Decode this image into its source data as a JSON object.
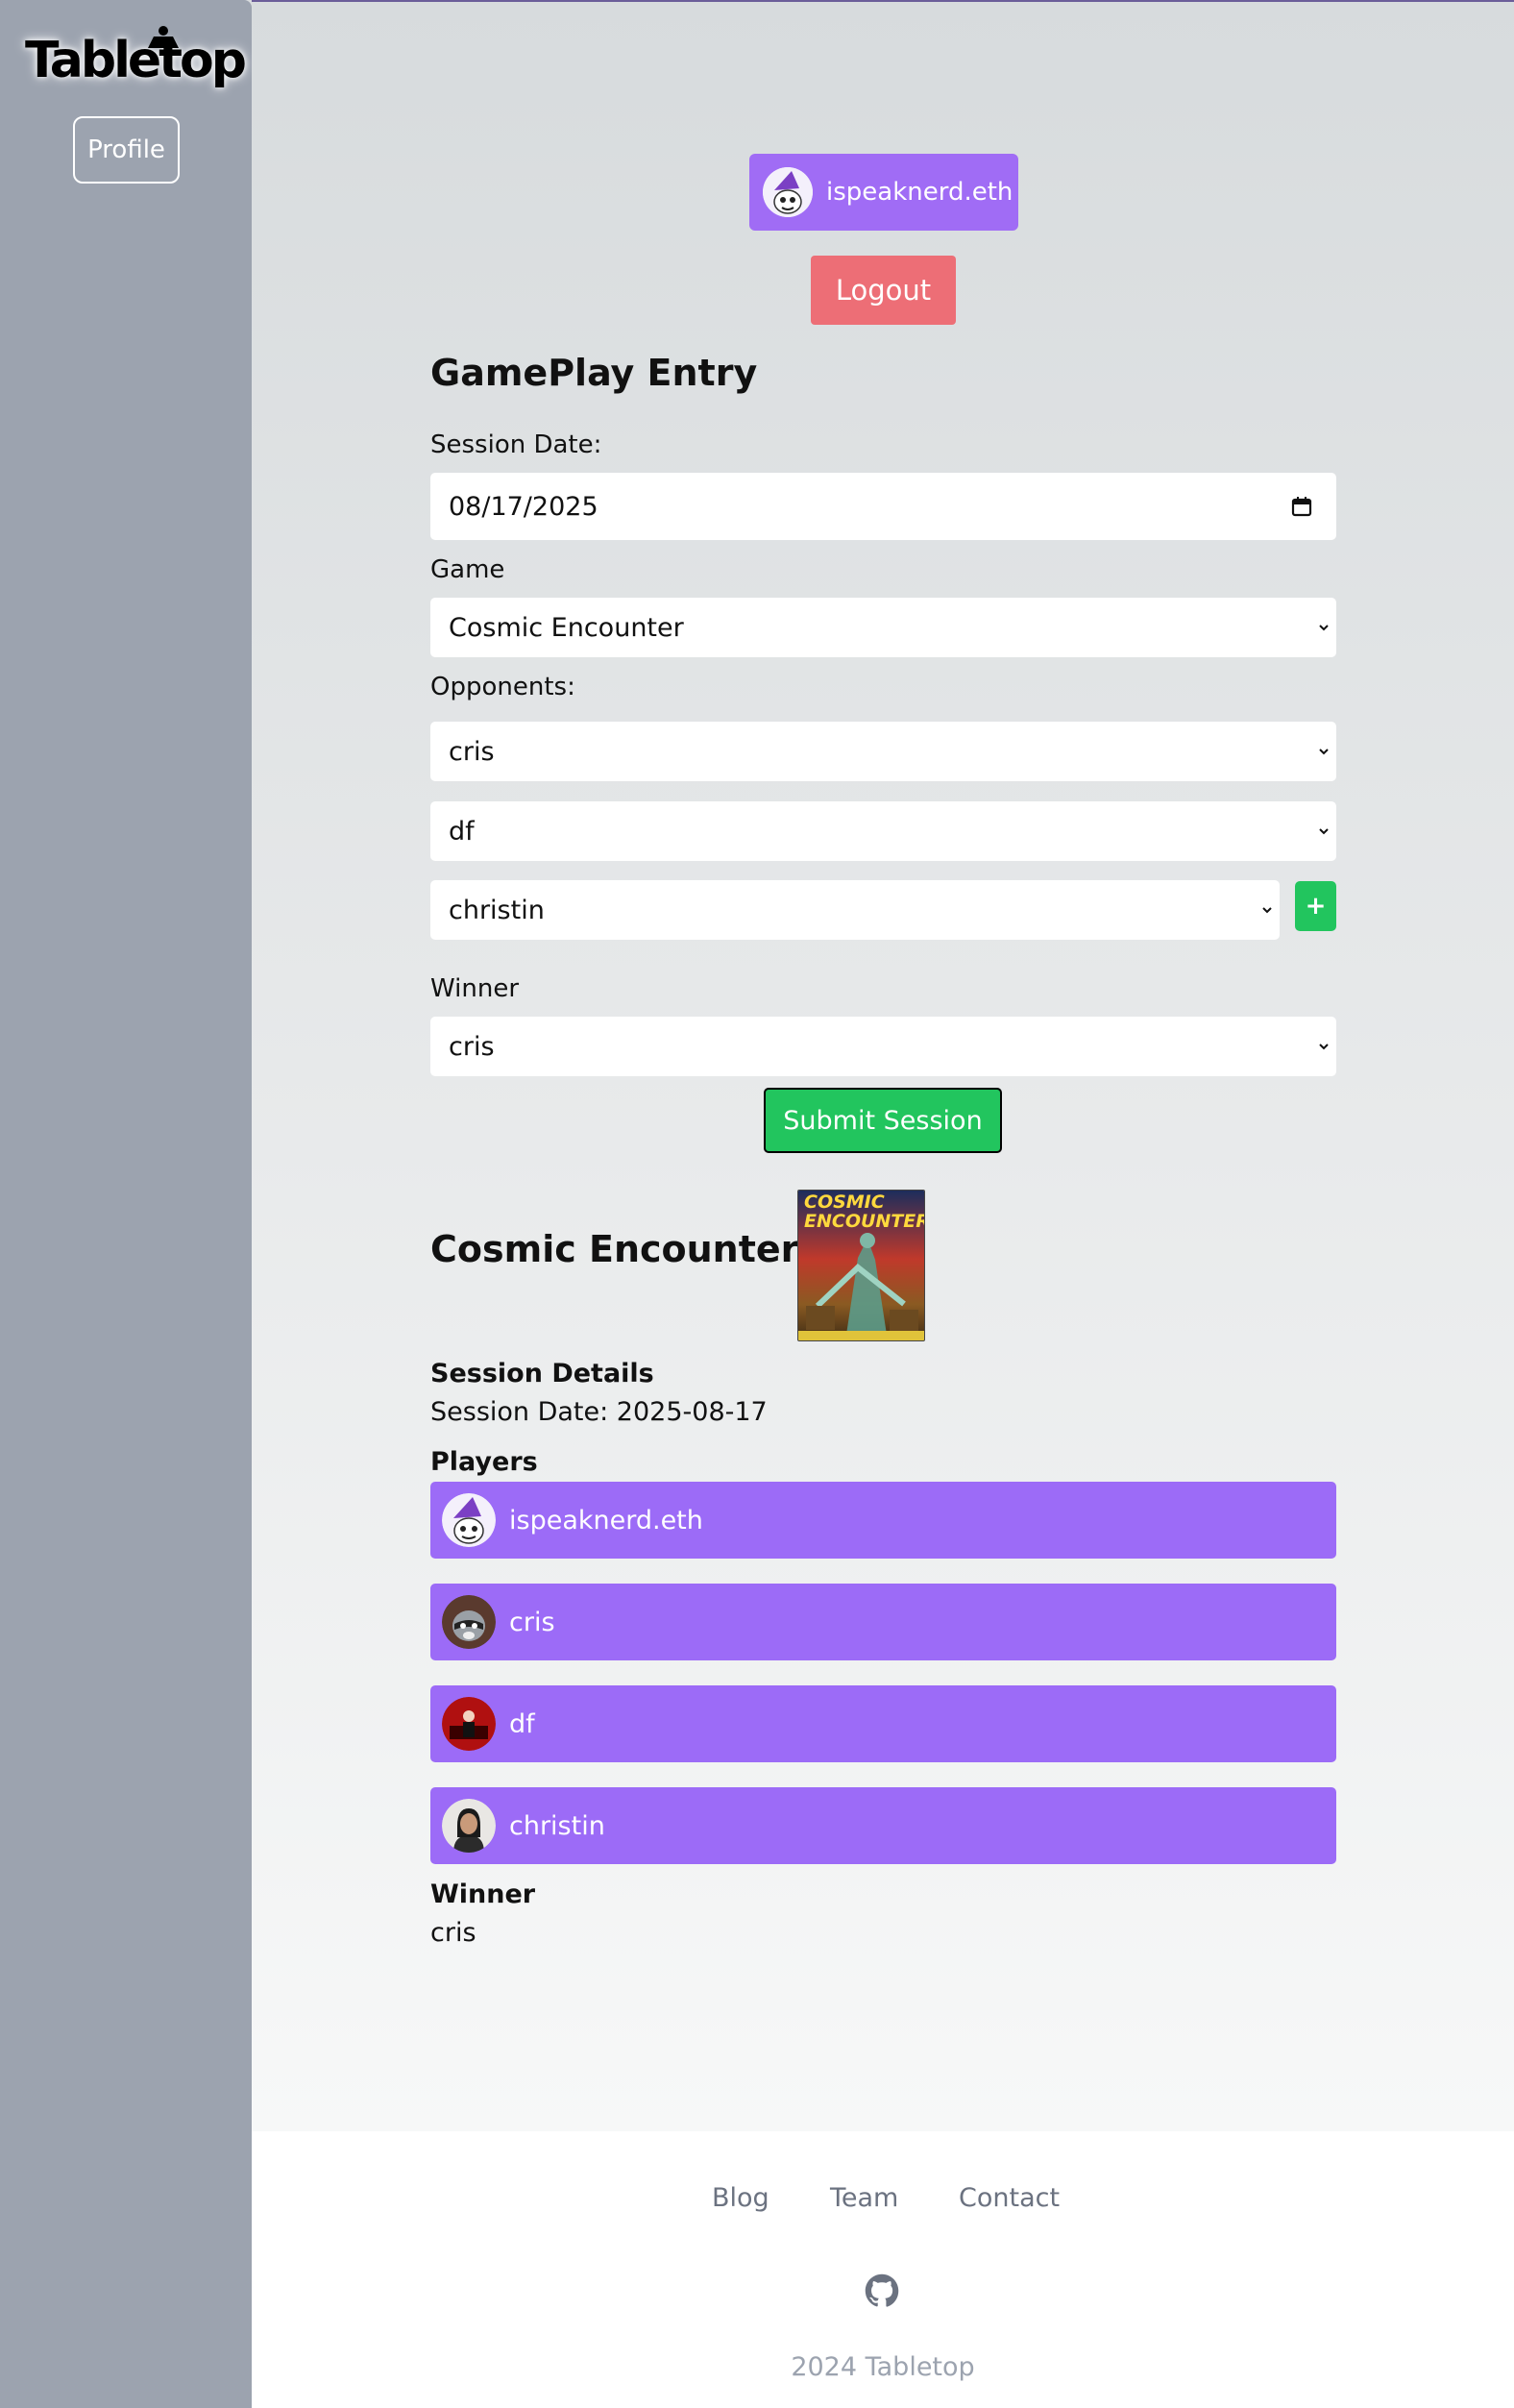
{
  "sidebar": {
    "logo_text": "Tabletop",
    "profile_label": "Profile"
  },
  "header": {
    "username": "ispeaknerd.eth",
    "logout_label": "Logout"
  },
  "form": {
    "title": "GamePlay Entry",
    "session_date_label": "Session Date:",
    "session_date_value": "08/17/2025",
    "game_label": "Game",
    "game_value": "Cosmic Encounter",
    "opponents_label": "Opponents:",
    "opponents": [
      "cris",
      "df",
      "christin"
    ],
    "add_label": "+",
    "winner_label": "Winner",
    "winner_value": "cris",
    "submit_label": "Submit Session"
  },
  "summary": {
    "game_title": "Cosmic Encounter",
    "art_line1": "COSMIC",
    "art_line2": "ENCOUNTER",
    "session_details_label": "Session Details",
    "session_date_text": "Session Date: 2025-08-17",
    "players_label": "Players",
    "players": [
      "ispeaknerd.eth",
      "cris",
      "df",
      "christin"
    ],
    "winner_label": "Winner",
    "winner_value": "cris"
  },
  "footer": {
    "links": [
      "Blog",
      "Team",
      "Contact"
    ],
    "copyright": "2024 Tabletop"
  },
  "colors": {
    "sidebar": "#9ca3af",
    "purple": "#9c6bf7",
    "logout": "#ed6e76",
    "green": "#22c55e"
  }
}
